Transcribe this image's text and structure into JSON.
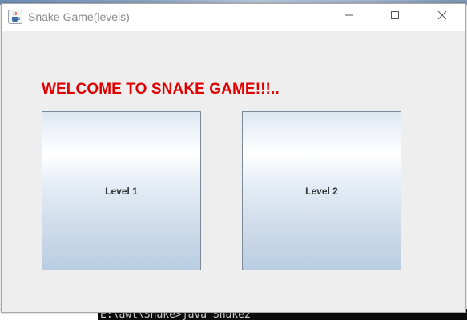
{
  "window": {
    "title": "Snake Game(levels)",
    "icon": "java-cup-icon",
    "controls": {
      "minimize_icon": "minimize-icon",
      "maximize_icon": "maximize-icon",
      "close_icon": "close-icon"
    }
  },
  "main": {
    "welcome_text": "WELCOME TO SNAKE GAME!!!..",
    "welcome_color": "#e00000",
    "levels": [
      {
        "label": "Level 1"
      },
      {
        "label": "Level 2"
      }
    ]
  },
  "background": {
    "console_text": "E:\\awt\\Snake>java Snake2"
  }
}
